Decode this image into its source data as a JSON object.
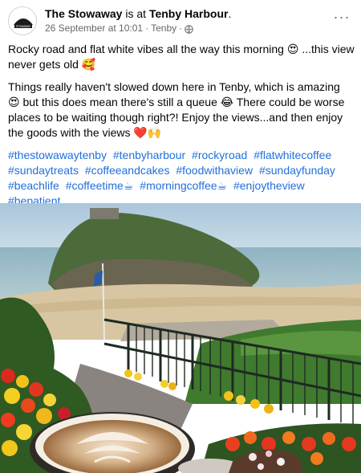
{
  "post": {
    "author": "The Stowaway",
    "at_text": "is at",
    "location": "Tenby Harbour",
    "location_suffix": ".",
    "date": "26 September at 10:01",
    "separator1": "·",
    "place": "Tenby",
    "separator2": "·",
    "privacy_icon": "globe-icon",
    "more_icon": "more-options-icon",
    "more_label": "···",
    "avatar_text": "THE STOWAWAY",
    "paragraph1": "Rocky road and flat white vibes all the way this morning 😍 ...this view never gets old 🥰",
    "paragraph2": "Things really haven't slowed down here in Tenby, which is amazing 😍 but this does mean there's still a queue 😂 There could be worse places to be waiting though right?! Enjoy the views...and then enjoy the goods with the views ❤️🙌",
    "hashtags": [
      "#thestowawaytenby",
      "#tenbyharbour",
      "#rockyroad",
      "#flatwhitecoffee",
      "#sundaytreats",
      "#coffeeandcakes",
      "#foodwithaview",
      "#sundayfunday",
      "#beachlife",
      "#coffeetime☕",
      "#morningcoffee☕",
      "#enjoytheview",
      "#bepatient"
    ]
  },
  "colors": {
    "link": "#216fdb",
    "secondary_text": "#65676b",
    "sky": "#b9d3e3",
    "sea": "#8fb8c9",
    "sand": "#d9c7a6",
    "grass": "#3f7a2e"
  }
}
